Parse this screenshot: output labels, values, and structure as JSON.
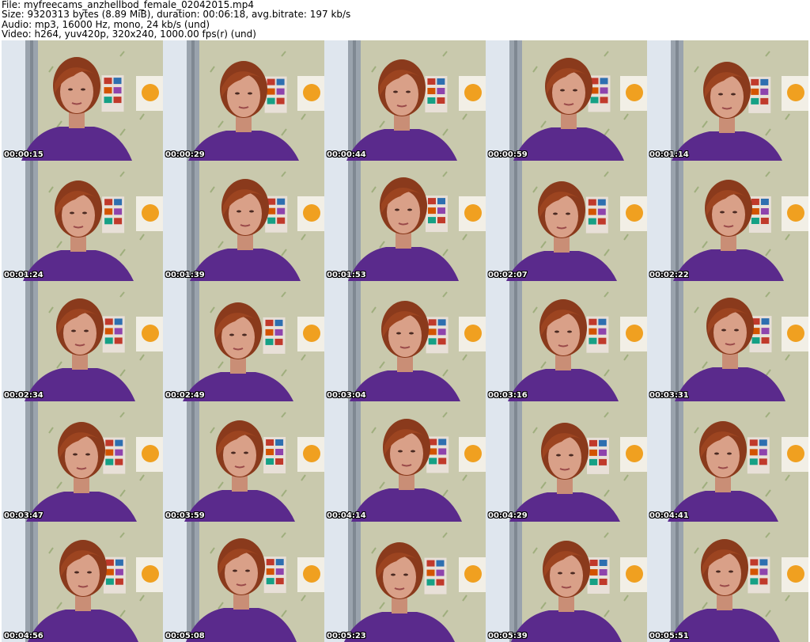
{
  "header": {
    "file_line": "File: myfreecams_anzhellbod_female_02042015.mp4",
    "size_line": "Size: 9320313 bytes (8.89 MiB), duration: 00:06:18, avg.bitrate: 197 kb/s",
    "audio_line": "Audio: mp3, 16000 Hz, mono, 24 kb/s (und)",
    "video_line": "Video: h264, yuv420p, 320x240, 1000.00 fps(r) (und)"
  },
  "thumbnails": [
    {
      "timestamp": "00:00:15"
    },
    {
      "timestamp": "00:00:29"
    },
    {
      "timestamp": "00:00:44"
    },
    {
      "timestamp": "00:00:59"
    },
    {
      "timestamp": "00:01:14"
    },
    {
      "timestamp": "00:01:24"
    },
    {
      "timestamp": "00:01:39"
    },
    {
      "timestamp": "00:01:53"
    },
    {
      "timestamp": "00:02:07"
    },
    {
      "timestamp": "00:02:22"
    },
    {
      "timestamp": "00:02:34"
    },
    {
      "timestamp": "00:02:49"
    },
    {
      "timestamp": "00:03:04"
    },
    {
      "timestamp": "00:03:16"
    },
    {
      "timestamp": "00:03:31"
    },
    {
      "timestamp": "00:03:47"
    },
    {
      "timestamp": "00:03:59"
    },
    {
      "timestamp": "00:04:14"
    },
    {
      "timestamp": "00:04:29"
    },
    {
      "timestamp": "00:04:41"
    },
    {
      "timestamp": "00:04:56"
    },
    {
      "timestamp": "00:05:08"
    },
    {
      "timestamp": "00:05:23"
    },
    {
      "timestamp": "00:05:39"
    },
    {
      "timestamp": "00:05:51"
    }
  ]
}
